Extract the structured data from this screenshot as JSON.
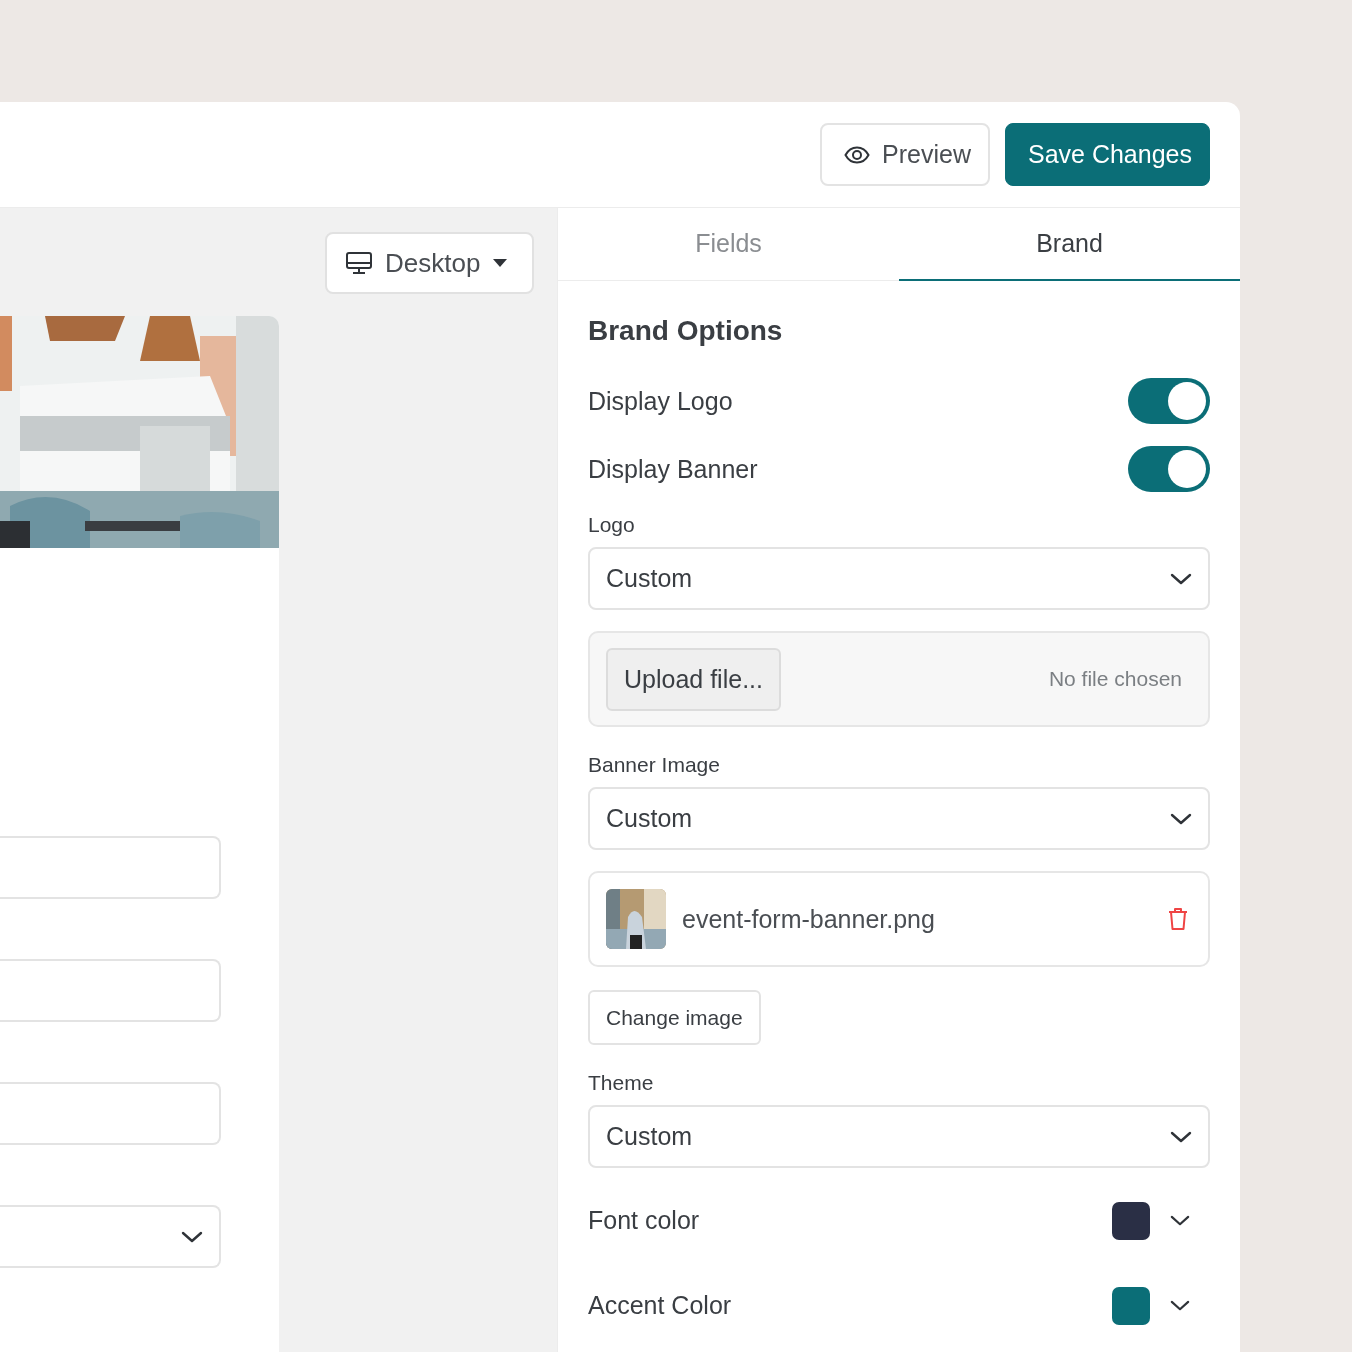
{
  "header": {
    "buttons": [
      {
        "kind": "outline",
        "label": "Preview"
      },
      {
        "kind": "primary",
        "label": "Save Changes"
      }
    ]
  },
  "preview": {
    "device": "Desktop",
    "fields": [
      {
        "kind": "input"
      },
      {
        "kind": "input"
      },
      {
        "kind": "input"
      },
      {
        "kind": "select"
      }
    ]
  },
  "tabs": [
    {
      "label": "Fields",
      "selected": false
    },
    {
      "label": "Brand",
      "selected": true
    }
  ],
  "brand_options": {
    "title": "Brand Options",
    "toggles": [
      {
        "label": "Display Logo",
        "on": true
      },
      {
        "label": "Display Banner",
        "on": true
      }
    ],
    "logo": {
      "label": "Logo",
      "value": "Custom",
      "upload_button": "Upload file...",
      "file_status": "No file chosen"
    },
    "banner_image": {
      "label": "Banner Image",
      "value": "Custom",
      "file_name": "event-form-banner.png",
      "change_button": "Change image"
    },
    "theme": {
      "label": "Theme",
      "value": "Custom"
    },
    "colors": [
      {
        "label": "Font color",
        "color": "#2a2f45"
      },
      {
        "label": "Accent Color",
        "color": "#0b6e77"
      }
    ]
  }
}
